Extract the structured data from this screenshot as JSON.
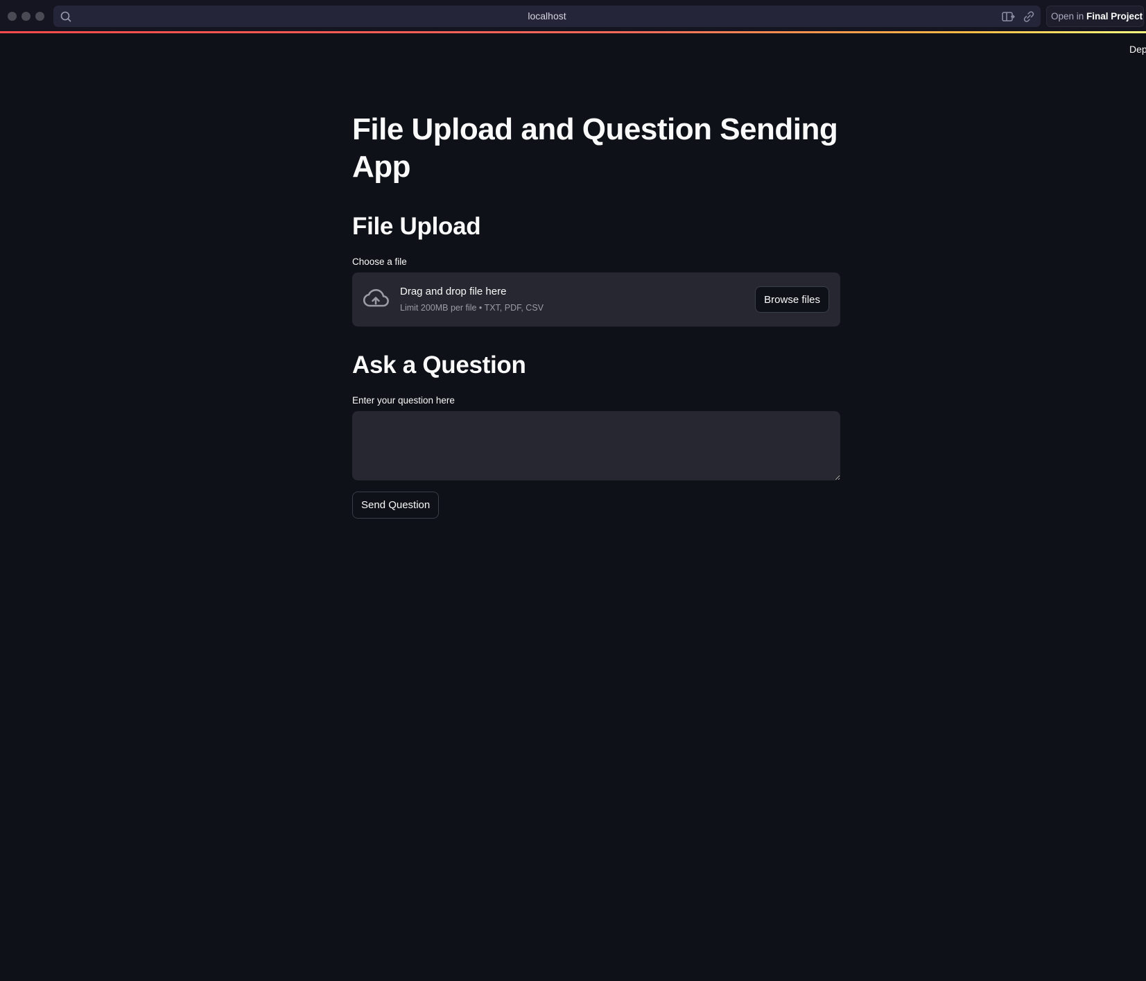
{
  "browser": {
    "url": "localhost",
    "open_in_label": "Open in",
    "open_in_target": "Final Project",
    "icons": [
      "search-icon",
      "side-panel-icon",
      "link-icon"
    ]
  },
  "header": {
    "deploy_label": "Dep"
  },
  "main": {
    "title": "File Upload and Question Sending App",
    "upload_section": {
      "heading": "File Upload",
      "label": "Choose a file",
      "dropzone_title": "Drag and drop file here",
      "dropzone_subtitle": "Limit 200MB per file • TXT, PDF, CSV",
      "browse_label": "Browse files",
      "icon": "cloud-upload-icon"
    },
    "question_section": {
      "heading": "Ask a Question",
      "label": "Enter your question here",
      "value": "",
      "send_label": "Send Question"
    }
  },
  "colors": {
    "background": "#0e1117",
    "surface": "#262730",
    "accent": "#ff4b4b"
  }
}
